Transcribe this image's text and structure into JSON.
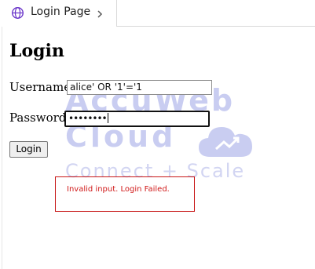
{
  "tab": {
    "label": "Login Page",
    "icon": "globe-icon",
    "chevron_icon": "chevron-right-icon"
  },
  "watermark": {
    "line1": "AccuWeb",
    "line2": "Cloud",
    "line3": "Connect + Scale",
    "icon": "cloud-upload-icon",
    "color": "#c9cdf1"
  },
  "form": {
    "title": "Login",
    "username_label": "Username:",
    "username_value": "alice' OR '1'='1",
    "password_label": "Password:",
    "password_value": "••••••••",
    "submit_label": "Login"
  },
  "error": {
    "message": "Invalid input. Login Failed.",
    "color": "#d11a1a"
  }
}
